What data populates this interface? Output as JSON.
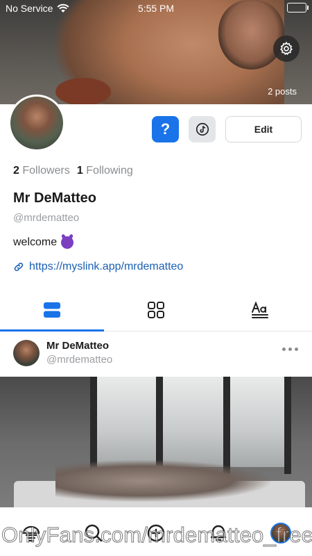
{
  "status_bar": {
    "carrier": "No Service",
    "time": "5:55 PM"
  },
  "cover": {
    "posts_count": "2 posts"
  },
  "profile": {
    "followers_count": "2",
    "followers_label": "Followers",
    "following_count": "1",
    "following_label": "Following",
    "display_name": "Mr DeMatteo",
    "handle": "@mrdematteo",
    "bio": "welcome",
    "link": "https://myslink.app/mrdematteo"
  },
  "actions": {
    "help_label": "?",
    "edit_label": "Edit"
  },
  "tabs": [
    {
      "icon": "feed-view-icon",
      "active": true
    },
    {
      "icon": "grid-view-icon",
      "active": false
    },
    {
      "icon": "text-posts-icon",
      "active": false
    }
  ],
  "post": {
    "author_name": "Mr DeMatteo",
    "author_handle": "@mrdematteo"
  },
  "bottom_nav": [
    "home-icon",
    "search-icon",
    "create-icon",
    "notifications-icon",
    "profile-avatar"
  ],
  "watermark": "OnlyFans.com/mrdematteo_free",
  "colors": {
    "accent": "#1a73e8",
    "link": "#1a5fb4",
    "muted": "#9a9da1"
  }
}
